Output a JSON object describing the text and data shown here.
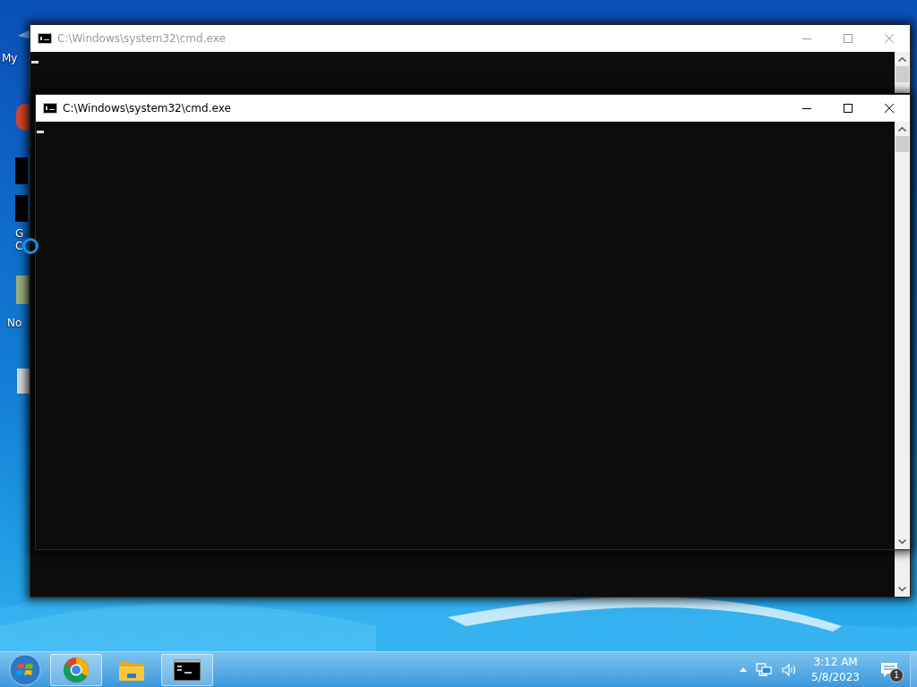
{
  "desktop": {
    "icons": [
      {
        "label": [
          "My"
        ]
      },
      {
        "label": [
          "G",
          "C"
        ]
      },
      {
        "label": [
          "No"
        ]
      }
    ]
  },
  "windows": [
    {
      "title": "C:\\Windows\\system32\\cmd.exe",
      "active": false
    },
    {
      "title": "C:\\Windows\\system32\\cmd.exe",
      "active": true
    }
  ],
  "taskbar": {
    "items": [
      {
        "kind": "browser",
        "running": true
      },
      {
        "kind": "folder",
        "running": false
      },
      {
        "kind": "console",
        "running": true
      }
    ]
  },
  "tray": {
    "time": "3:12 AM",
    "date": "5/8/2023",
    "notification_count": "1"
  }
}
